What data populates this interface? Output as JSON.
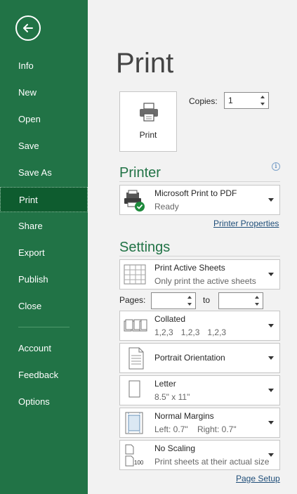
{
  "sidebar": {
    "back_icon": "arrow-left-icon",
    "items": [
      {
        "label": "Info"
      },
      {
        "label": "New"
      },
      {
        "label": "Open"
      },
      {
        "label": "Save"
      },
      {
        "label": "Save As"
      },
      {
        "label": "Print",
        "active": true
      },
      {
        "label": "Share"
      },
      {
        "label": "Export"
      },
      {
        "label": "Publish"
      },
      {
        "label": "Close"
      },
      {
        "label": "Account"
      },
      {
        "label": "Feedback"
      },
      {
        "label": "Options"
      }
    ]
  },
  "main": {
    "title": "Print",
    "print_button": {
      "label": "Print",
      "icon": "printer-icon"
    },
    "copies": {
      "label": "Copies:",
      "value": "1"
    },
    "printer": {
      "heading": "Printer",
      "name": "Microsoft Print to PDF",
      "status": "Ready",
      "properties_link": "Printer Properties"
    },
    "settings": {
      "heading": "Settings",
      "what_to_print": {
        "title": "Print Active Sheets",
        "sub": "Only print the active sheets"
      },
      "pages": {
        "label": "Pages:",
        "to_label": "to",
        "from": "",
        "to": ""
      },
      "collation": {
        "title": "Collated",
        "sub": [
          "1,2,3",
          "1,2,3",
          "1,2,3"
        ]
      },
      "orientation": {
        "title": "Portrait Orientation"
      },
      "paper": {
        "title": "Letter",
        "sub": "8.5\" x 11\""
      },
      "margins": {
        "title": "Normal Margins",
        "sub_left": "Left:  0.7\"",
        "sub_right": "Right:  0.7\""
      },
      "scaling": {
        "title": "No Scaling",
        "sub": "Print sheets at their actual size",
        "icon_text": "100"
      },
      "page_setup_link": "Page Setup"
    }
  },
  "colors": {
    "accent": "#217346",
    "sidebar_active": "#0e5c2f",
    "link": "#1f4e79"
  }
}
